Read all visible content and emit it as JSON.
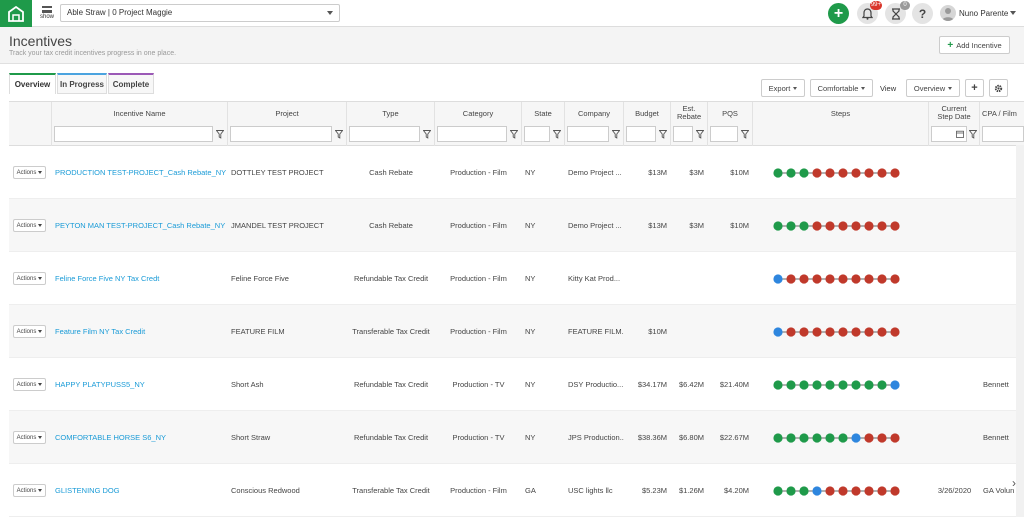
{
  "topbar": {
    "show_label": "show",
    "project_value": "Able Straw | 0 Project Maggie",
    "notifications_count": "99+",
    "tasks_count": "0",
    "help_glyph": "?",
    "add_glyph": "+",
    "user_name": "Nuno Parente",
    "icons": [
      "logo-icon",
      "menu-icon",
      "plus-icon",
      "bell-icon",
      "hourglass-icon",
      "help-icon",
      "avatar"
    ]
  },
  "header": {
    "title": "Incentives",
    "subtitle": "Track your tax credit incentives progress in one place.",
    "add_button": "Add Incentive"
  },
  "tabs": [
    {
      "label": "Overview",
      "active": true,
      "color": "#1f9a4a"
    },
    {
      "label": "In Progress",
      "active": false,
      "color": "#4aa3df"
    },
    {
      "label": "Complete",
      "active": false,
      "color": "#9b59b6"
    }
  ],
  "toolbar": {
    "export": "Export",
    "density": "Comfortable",
    "view_label": "View",
    "view_value": "Overview",
    "add_glyph": "+"
  },
  "columns": {
    "incentive_name": "Incentive Name",
    "project": "Project",
    "type": "Type",
    "category": "Category",
    "state": "State",
    "company": "Company",
    "budget": "Budget",
    "est_rebate": "Est. Rebate",
    "pqs": "PQS",
    "steps": "Steps",
    "current_step_date": "Current Step Date",
    "cpa": "CPA / Film"
  },
  "actions_label": "Actions",
  "colors": {
    "green": "#1f9a4a",
    "red": "#c0392b",
    "blue": "#2e86de",
    "link": "#1a9bd7"
  },
  "rows": [
    {
      "name": "PRODUCTION TEST-PROJECT_Cash Rebate_NY",
      "project": "DOTTLEY TEST PROJECT",
      "type": "Cash Rebate",
      "category": "Production - Film",
      "state": "NY",
      "company": "Demo Project ...",
      "budget": "$13M",
      "est_rebate": "$3M",
      "pqs": "$10M",
      "steps": [
        "g",
        "g",
        "g",
        "r",
        "r",
        "r",
        "r",
        "r",
        "r",
        "r"
      ],
      "date": "",
      "cpa": ""
    },
    {
      "name": "PEYTON MAN TEST-PROJECT_Cash Rebate_NY",
      "project": "JMANDEL TEST PROJECT",
      "type": "Cash Rebate",
      "category": "Production - Film",
      "state": "NY",
      "company": "Demo Project ...",
      "budget": "$13M",
      "est_rebate": "$3M",
      "pqs": "$10M",
      "steps": [
        "g",
        "g",
        "g",
        "r",
        "r",
        "r",
        "r",
        "r",
        "r",
        "r"
      ],
      "date": "",
      "cpa": ""
    },
    {
      "name": "Feline Force Five NY Tax Credt",
      "project": "Feline Force Five",
      "type": "Refundable Tax Credit",
      "category": "Production - Film",
      "state": "NY",
      "company": "Kitty Kat Prod...",
      "budget": "",
      "est_rebate": "",
      "pqs": "",
      "steps": [
        "b",
        "r",
        "r",
        "r",
        "r",
        "r",
        "r",
        "r",
        "r",
        "r"
      ],
      "date": "",
      "cpa": ""
    },
    {
      "name": "Feature Film NY Tax Credit",
      "project": "FEATURE FILM",
      "type": "Transferable Tax Credit",
      "category": "Production - Film",
      "state": "NY",
      "company": "FEATURE FILM...",
      "budget": "$10M",
      "est_rebate": "",
      "pqs": "",
      "steps": [
        "b",
        "r",
        "r",
        "r",
        "r",
        "r",
        "r",
        "r",
        "r",
        "r"
      ],
      "date": "",
      "cpa": ""
    },
    {
      "name": "HAPPY PLATYPUSS5_NY",
      "project": "Short Ash",
      "type": "Refundable Tax Credit",
      "category": "Production - TV",
      "state": "NY",
      "company": "DSY Productio...",
      "budget": "$34.17M",
      "est_rebate": "$6.42M",
      "pqs": "$21.40M",
      "steps": [
        "g",
        "g",
        "g",
        "g",
        "g",
        "g",
        "g",
        "g",
        "g",
        "b"
      ],
      "date": "",
      "cpa": "Bennett"
    },
    {
      "name": "COMFORTABLE HORSE S6_NY",
      "project": "Short Straw",
      "type": "Refundable Tax Credit",
      "category": "Production - TV",
      "state": "NY",
      "company": "JPS Production...",
      "budget": "$38.36M",
      "est_rebate": "$6.80M",
      "pqs": "$22.67M",
      "steps": [
        "g",
        "g",
        "g",
        "g",
        "g",
        "g",
        "b",
        "r",
        "r",
        "r"
      ],
      "date": "",
      "cpa": "Bennett"
    },
    {
      "name": "GLISTENING DOG",
      "project": "Conscious Redwood",
      "type": "Transferable Tax Credit",
      "category": "Production - Film",
      "state": "GA",
      "company": "USC lights llc",
      "budget": "$5.23M",
      "est_rebate": "$1.26M",
      "pqs": "$4.20M",
      "steps": [
        "g",
        "g",
        "g",
        "b",
        "r",
        "r",
        "r",
        "r",
        "r",
        "r"
      ],
      "date": "3/26/2020",
      "cpa": "GA Volun"
    }
  ]
}
